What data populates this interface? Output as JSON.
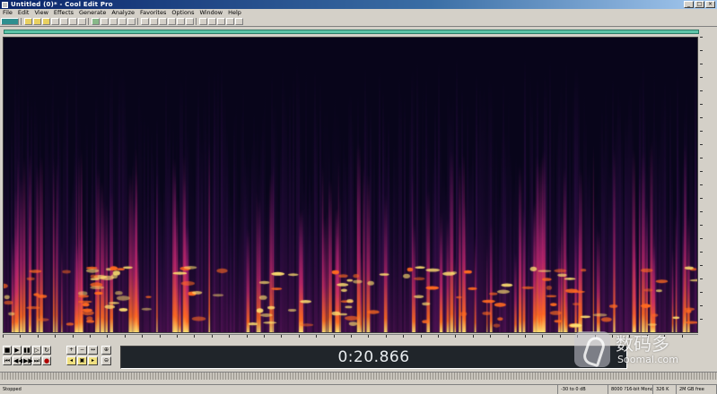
{
  "window": {
    "title": "Untitled (0)* - Cool Edit Pro",
    "minimize": "_",
    "maximize": "□",
    "close": "×"
  },
  "menu": [
    "File",
    "Edit",
    "View",
    "Effects",
    "Generate",
    "Analyze",
    "Favorites",
    "Options",
    "Window",
    "Help"
  ],
  "display": {
    "view": "spectral",
    "colors": {
      "background": "#08051a",
      "low": "#3a0a5a",
      "mid": "#a01e80",
      "high": "#ff6a20",
      "peak": "#ffe070",
      "time_panel": "#20252a"
    }
  },
  "transport": {
    "time": "0:20.866",
    "buttons": [
      "stop",
      "play",
      "pause",
      "play-to-end",
      "loop",
      "go-to-start",
      "rewind",
      "fast-forward",
      "go-to-end",
      "record"
    ]
  },
  "status": {
    "state": "Stopped",
    "level": "-30 to 0 dB",
    "sample_format": "8000 ?16-bit Mono",
    "size": "326 K",
    "free": "2M GB free"
  },
  "watermark": {
    "cn": "数码多",
    "en": "Soomal.com"
  }
}
